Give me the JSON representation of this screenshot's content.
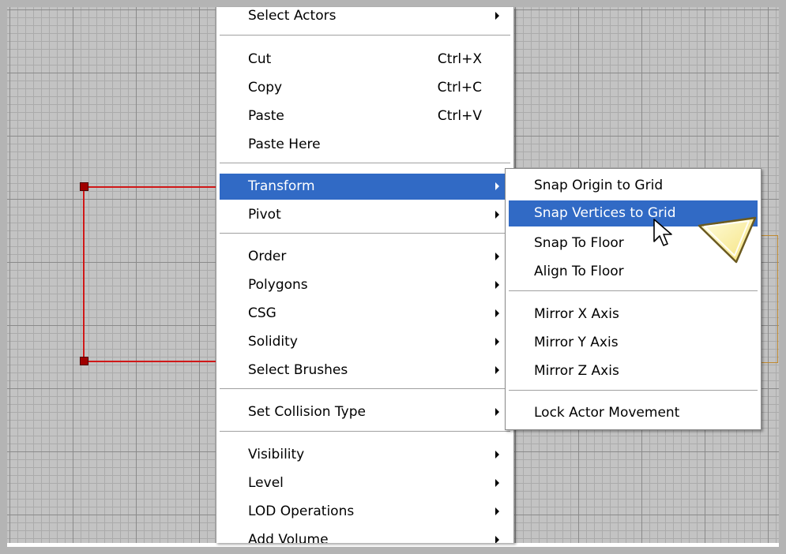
{
  "context_menu": {
    "items": [
      {
        "label": "Select Actors",
        "shortcut": "",
        "submenu": true
      },
      {
        "label": "Cut",
        "shortcut": "Ctrl+X",
        "submenu": false
      },
      {
        "label": "Copy",
        "shortcut": "Ctrl+C",
        "submenu": false
      },
      {
        "label": "Paste",
        "shortcut": "Ctrl+V",
        "submenu": false
      },
      {
        "label": "Paste Here",
        "shortcut": "",
        "submenu": false
      },
      {
        "label": "Transform",
        "shortcut": "",
        "submenu": true,
        "highlighted": true
      },
      {
        "label": "Pivot",
        "shortcut": "",
        "submenu": true
      },
      {
        "label": "Order",
        "shortcut": "",
        "submenu": true
      },
      {
        "label": "Polygons",
        "shortcut": "",
        "submenu": true
      },
      {
        "label": "CSG",
        "shortcut": "",
        "submenu": true
      },
      {
        "label": "Solidity",
        "shortcut": "",
        "submenu": true
      },
      {
        "label": "Select Brushes",
        "shortcut": "",
        "submenu": true
      },
      {
        "label": "Set Collision Type",
        "shortcut": "",
        "submenu": true
      },
      {
        "label": "Visibility",
        "shortcut": "",
        "submenu": true
      },
      {
        "label": "Level",
        "shortcut": "",
        "submenu": true
      },
      {
        "label": "LOD Operations",
        "shortcut": "",
        "submenu": true
      },
      {
        "label": "Add Volume",
        "shortcut": "",
        "submenu": true
      }
    ]
  },
  "transform_submenu": {
    "items": [
      {
        "label": "Snap Origin to Grid"
      },
      {
        "label": "Snap Vertices to Grid",
        "highlighted": true
      },
      {
        "label": "Snap To Floor"
      },
      {
        "label": "Align To Floor"
      },
      {
        "label": "Mirror X Axis"
      },
      {
        "label": "Mirror Y Axis"
      },
      {
        "label": "Mirror Z Axis"
      },
      {
        "label": "Lock Actor Movement"
      }
    ]
  },
  "colors": {
    "highlight": "#316ac5",
    "grid_background": "#c3c3c3",
    "brush_outline": "#d01818",
    "callout_fill": "#fff8c0"
  },
  "icons": {
    "cursor": "mouse-pointer-icon",
    "callout": "pointer-callout-icon"
  }
}
